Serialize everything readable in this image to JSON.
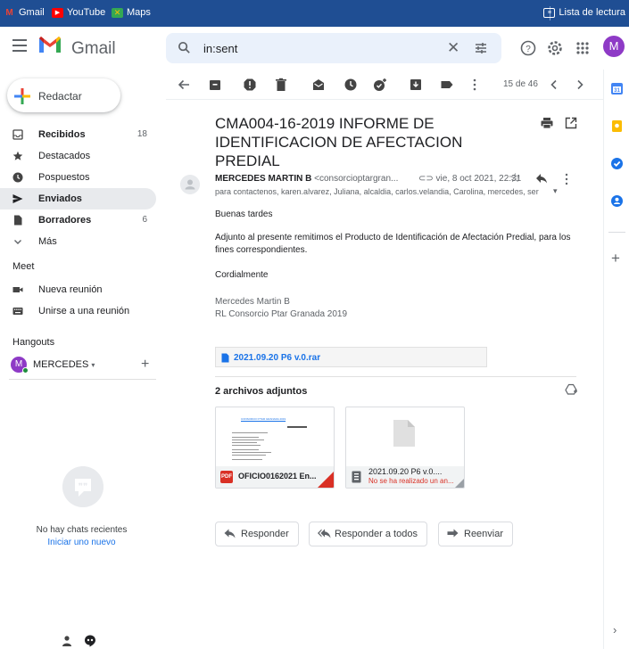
{
  "bookmarks": {
    "gmail": "Gmail",
    "youtube": "YouTube",
    "maps": "Maps",
    "reading_list": "Lista de lectura"
  },
  "header": {
    "app_name": "Gmail",
    "search_value": "in:sent",
    "avatar_letter": "M"
  },
  "sidebar": {
    "compose": "Redactar",
    "items": [
      {
        "label": "Recibidos",
        "count": "18"
      },
      {
        "label": "Destacados",
        "count": ""
      },
      {
        "label": "Pospuestos",
        "count": ""
      },
      {
        "label": "Enviados",
        "count": ""
      },
      {
        "label": "Borradores",
        "count": "6"
      },
      {
        "label": "Más",
        "count": ""
      }
    ],
    "meet_title": "Meet",
    "meet_items": [
      "Nueva reunión",
      "Unirse a una reunión"
    ],
    "hangouts_title": "Hangouts",
    "hangouts_user": "MERCEDES",
    "hangouts_avatar": "M",
    "no_chats": "No hay chats recientes",
    "start_new": "Iniciar uno nuevo"
  },
  "toolbar": {
    "pager": "15 de 46"
  },
  "email": {
    "subject": "CMA004-16-2019 INFORME DE IDENTIFICACION DE AFECTACION PREDIAL",
    "sender_name": "MERCEDES MARTIN B",
    "sender_email": "<consorcioptargran...",
    "date": "vie, 8 oct 2021, 22:31",
    "to": "para contactenos, karen.alvarez, Juliana, alcaldia, carlos.velandia, Carolina, mercedes, ser",
    "greeting": "Buenas tardes",
    "body": "Adjunto al presente remitimos el Producto de Identificación de Afectación Predial, para los fines correspondientes.",
    "closing": "Cordialmente",
    "sig_name": "Mercedes Martin B",
    "sig_org": "RL Consorcio Ptar Granada 2019",
    "inline_attachment": "2021.09.20 P6 v.0.rar",
    "attachments_title": "2 archivos adjuntos",
    "attachments": [
      {
        "name": "OFICIO0162021 En...",
        "badge": "PDF",
        "doc_title": "CONSORCIO PTAR GRANADA 2019",
        "error": ""
      },
      {
        "name": "2021.09.20 P6 v.0....",
        "badge": "",
        "error": "No se ha realizado un an..."
      }
    ]
  },
  "actions": {
    "reply": "Responder",
    "reply_all": "Responder a todos",
    "forward": "Reenviar"
  },
  "colors": {
    "bookmark_bar": "#1f4e93",
    "accent": "#1a73e8",
    "error": "#d93025",
    "avatar": "#8e3ac6"
  }
}
